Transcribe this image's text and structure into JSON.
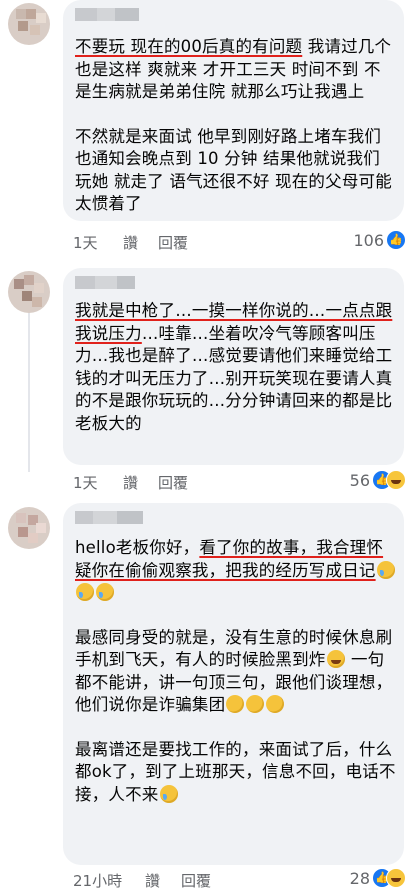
{
  "comments": [
    {
      "paragraphs": [
        [
          {
            "t": "不要玩 现在的00后真的有问题",
            "hl": true
          },
          {
            "t": " 我请过几个也是这样 爽就来 才开工三天 时间不到 不是生病就是弟弟住院 就那么巧让我遇上"
          }
        ],
        [
          {
            "t": "不然就是来面试 他早到刚好路上堵车我们也通知会晚点到 10 分钟 结果他就说我们玩她 就走了 语气还很不好 现在的父母可能太惯着了"
          }
        ]
      ],
      "time": "1天",
      "like_label": "讚",
      "reply_label": "回覆",
      "reaction_count": "106"
    },
    {
      "paragraphs": [
        [
          {
            "t": "我就是中枪了…一摸一样你说的…一点点跟我说压力",
            "hl": true
          },
          {
            "t": "…哇靠…坐着吹冷气等顾客叫压力…我也是醉了…感觉要请他们来睡觉给工钱的才叫无压力了…别开玩笑现在要请人真的不是跟你玩玩的…分分钟请回来的都是比老板大的"
          }
        ]
      ],
      "time": "1天",
      "like_label": "讚",
      "reply_label": "回覆",
      "reaction_count": "56"
    },
    {
      "paragraphs": [
        [
          {
            "t": "hello老板你好，"
          },
          {
            "t": "看了你的故事，我合理怀疑你在偷偷观察我，把我的经历写成日记",
            "hl": true
          },
          {
            "e": "cry"
          },
          {
            "e": "cry"
          },
          {
            "e": "cry"
          }
        ],
        [
          {
            "t": "最感同身受的就是，没有生意的时候休息刷手机到飞天，有人的时候脸黑到炸"
          },
          {
            "e": "laugh"
          },
          {
            "t": " 一句都不能讲，讲一句顶三句，跟他们谈理想，他们说你是诈骗集团"
          },
          {
            "e": "tilt"
          },
          {
            "e": "tilt"
          },
          {
            "e": "tilt"
          }
        ],
        [
          {
            "t": "最离谱还是要找工作的，来面试了后，什么都ok了，到了上班那天，信息不回，电话不接，人不来"
          },
          {
            "e": "cry"
          }
        ]
      ],
      "time": "21小時",
      "like_label": "讚",
      "reply_label": "回覆",
      "reaction_count": "28"
    }
  ],
  "colors": {
    "bubble": "#f0f2f5",
    "underline": "#e0211b",
    "meta": "#65676b",
    "like": "#1877f2"
  },
  "icons": {
    "like": "thumbs-up-icon",
    "haha": "laughing-face-icon"
  }
}
